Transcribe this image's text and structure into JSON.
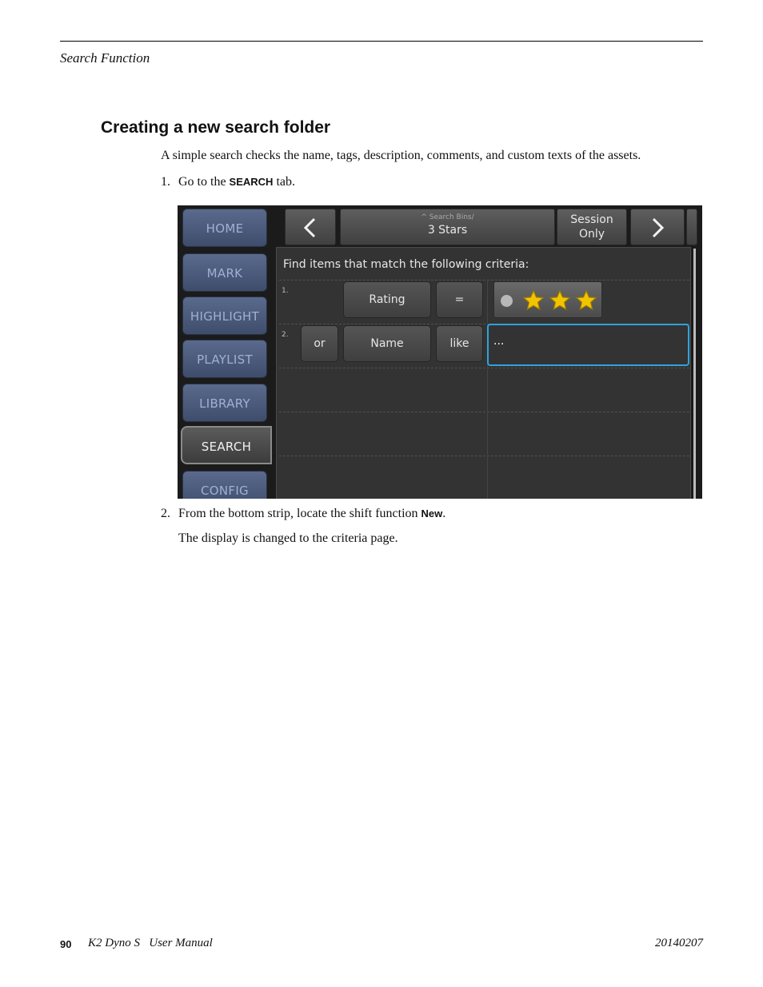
{
  "header": {
    "section": "Search Function"
  },
  "heading": "Creating a new search folder",
  "intro": "A simple search checks the name, tags, description, comments, and custom texts of the assets.",
  "steps": [
    {
      "num": "1.",
      "before": "Go to the ",
      "keyword": "SEARCH",
      "after": " tab."
    },
    {
      "num": "2.",
      "before": "From the bottom strip, locate the shift function ",
      "keyword": "New",
      "after": "."
    }
  ],
  "result_text": "The display is changed to the criteria page.",
  "screenshot": {
    "side_tabs": [
      "HOME",
      "MARK",
      "HIGHLIGHT",
      "PLAYLIST",
      "LIBRARY",
      "SEARCH",
      "CONFIG"
    ],
    "active_tab": "SEARCH",
    "breadcrumb": "^ Search Bins/",
    "folder": "3 Stars",
    "session_line1": "Session",
    "session_line2": "Only",
    "criteria_title": "Find items that match the following criteria:",
    "row1": {
      "num": "1.",
      "field": "Rating",
      "operator": "=",
      "value_stars": 3
    },
    "row2": {
      "num": "2.",
      "conjunction": "or",
      "field": "Name",
      "operator": "like",
      "value": "..."
    },
    "colors": {
      "accent": "#2fa3dc",
      "star": "#f2c400",
      "tab": "#4a5878"
    }
  },
  "footer": {
    "page": "90",
    "title": "K2 Dyno S   User Manual",
    "date": "20140207"
  }
}
